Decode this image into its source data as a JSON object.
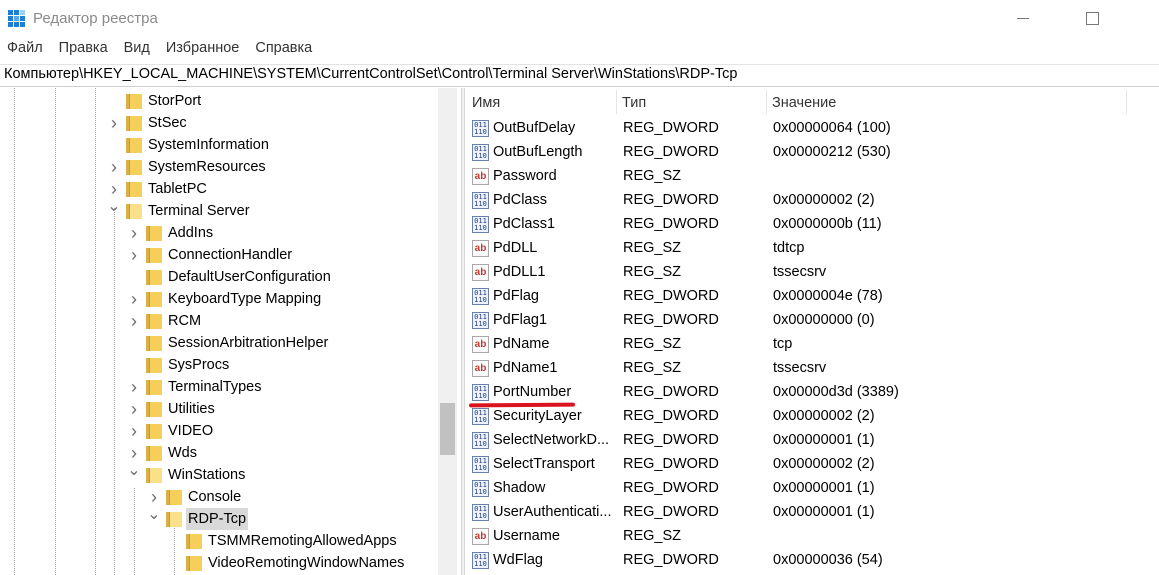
{
  "window": {
    "title": "Редактор реестра"
  },
  "menu": [
    "Файл",
    "Правка",
    "Вид",
    "Избранное",
    "Справка"
  ],
  "address": "Компьютер\\HKEY_LOCAL_MACHINE\\SYSTEM\\CurrentControlSet\\Control\\Terminal Server\\WinStations\\RDP-Tcp",
  "tree": [
    {
      "label": "StorPort",
      "level": 0,
      "expander": "none"
    },
    {
      "label": "StSec",
      "level": 0,
      "expander": "collapsed"
    },
    {
      "label": "SystemInformation",
      "level": 0,
      "expander": "none"
    },
    {
      "label": "SystemResources",
      "level": 0,
      "expander": "collapsed"
    },
    {
      "label": "TabletPC",
      "level": 0,
      "expander": "collapsed"
    },
    {
      "label": "Terminal Server",
      "level": 0,
      "expander": "expanded"
    },
    {
      "label": "AddIns",
      "level": 1,
      "expander": "collapsed"
    },
    {
      "label": "ConnectionHandler",
      "level": 1,
      "expander": "collapsed"
    },
    {
      "label": "DefaultUserConfiguration",
      "level": 1,
      "expander": "none"
    },
    {
      "label": "KeyboardType Mapping",
      "level": 1,
      "expander": "collapsed"
    },
    {
      "label": "RCM",
      "level": 1,
      "expander": "collapsed"
    },
    {
      "label": "SessionArbitrationHelper",
      "level": 1,
      "expander": "none"
    },
    {
      "label": "SysProcs",
      "level": 1,
      "expander": "none"
    },
    {
      "label": "TerminalTypes",
      "level": 1,
      "expander": "collapsed"
    },
    {
      "label": "Utilities",
      "level": 1,
      "expander": "collapsed"
    },
    {
      "label": "VIDEO",
      "level": 1,
      "expander": "collapsed"
    },
    {
      "label": "Wds",
      "level": 1,
      "expander": "collapsed"
    },
    {
      "label": "WinStations",
      "level": 1,
      "expander": "expanded"
    },
    {
      "label": "Console",
      "level": 2,
      "expander": "collapsed"
    },
    {
      "label": "RDP-Tcp",
      "level": 2,
      "expander": "expanded",
      "selected": true
    },
    {
      "label": "TSMMRemotingAllowedApps",
      "level": 3,
      "expander": "none"
    },
    {
      "label": "VideoRemotingWindowNames",
      "level": 3,
      "expander": "none"
    }
  ],
  "columns": {
    "name": "Имя",
    "type": "Тип",
    "value": "Значение"
  },
  "values": [
    {
      "icon": "binary-value-icon",
      "name": "OutBufDelay",
      "type": "REG_DWORD",
      "value": "0x00000064 (100)"
    },
    {
      "icon": "binary-value-icon",
      "name": "OutBufLength",
      "type": "REG_DWORD",
      "value": "0x00000212 (530)"
    },
    {
      "icon": "string-value-icon",
      "name": "Password",
      "type": "REG_SZ",
      "value": ""
    },
    {
      "icon": "binary-value-icon",
      "name": "PdClass",
      "type": "REG_DWORD",
      "value": "0x00000002 (2)"
    },
    {
      "icon": "binary-value-icon",
      "name": "PdClass1",
      "type": "REG_DWORD",
      "value": "0x0000000b (11)"
    },
    {
      "icon": "string-value-icon",
      "name": "PdDLL",
      "type": "REG_SZ",
      "value": "tdtcp"
    },
    {
      "icon": "string-value-icon",
      "name": "PdDLL1",
      "type": "REG_SZ",
      "value": "tssecsrv"
    },
    {
      "icon": "binary-value-icon",
      "name": "PdFlag",
      "type": "REG_DWORD",
      "value": "0x0000004e (78)"
    },
    {
      "icon": "binary-value-icon",
      "name": "PdFlag1",
      "type": "REG_DWORD",
      "value": "0x00000000 (0)"
    },
    {
      "icon": "string-value-icon",
      "name": "PdName",
      "type": "REG_SZ",
      "value": "tcp"
    },
    {
      "icon": "string-value-icon",
      "name": "PdName1",
      "type": "REG_SZ",
      "value": "tssecsrv"
    },
    {
      "icon": "binary-value-icon",
      "name": "PortNumber",
      "type": "REG_DWORD",
      "value": "0x00000d3d (3389)",
      "highlighted": true
    },
    {
      "icon": "binary-value-icon",
      "name": "SecurityLayer",
      "type": "REG_DWORD",
      "value": "0x00000002 (2)"
    },
    {
      "icon": "binary-value-icon",
      "name": "SelectNetworkD...",
      "type": "REG_DWORD",
      "value": "0x00000001 (1)"
    },
    {
      "icon": "binary-value-icon",
      "name": "SelectTransport",
      "type": "REG_DWORD",
      "value": "0x00000002 (2)"
    },
    {
      "icon": "binary-value-icon",
      "name": "Shadow",
      "type": "REG_DWORD",
      "value": "0x00000001 (1)"
    },
    {
      "icon": "binary-value-icon",
      "name": "UserAuthenticati...",
      "type": "REG_DWORD",
      "value": "0x00000001 (1)"
    },
    {
      "icon": "string-value-icon",
      "name": "Username",
      "type": "REG_SZ",
      "value": ""
    },
    {
      "icon": "binary-value-icon",
      "name": "WdFlag",
      "type": "REG_DWORD",
      "value": "0x00000036 (54)"
    }
  ]
}
